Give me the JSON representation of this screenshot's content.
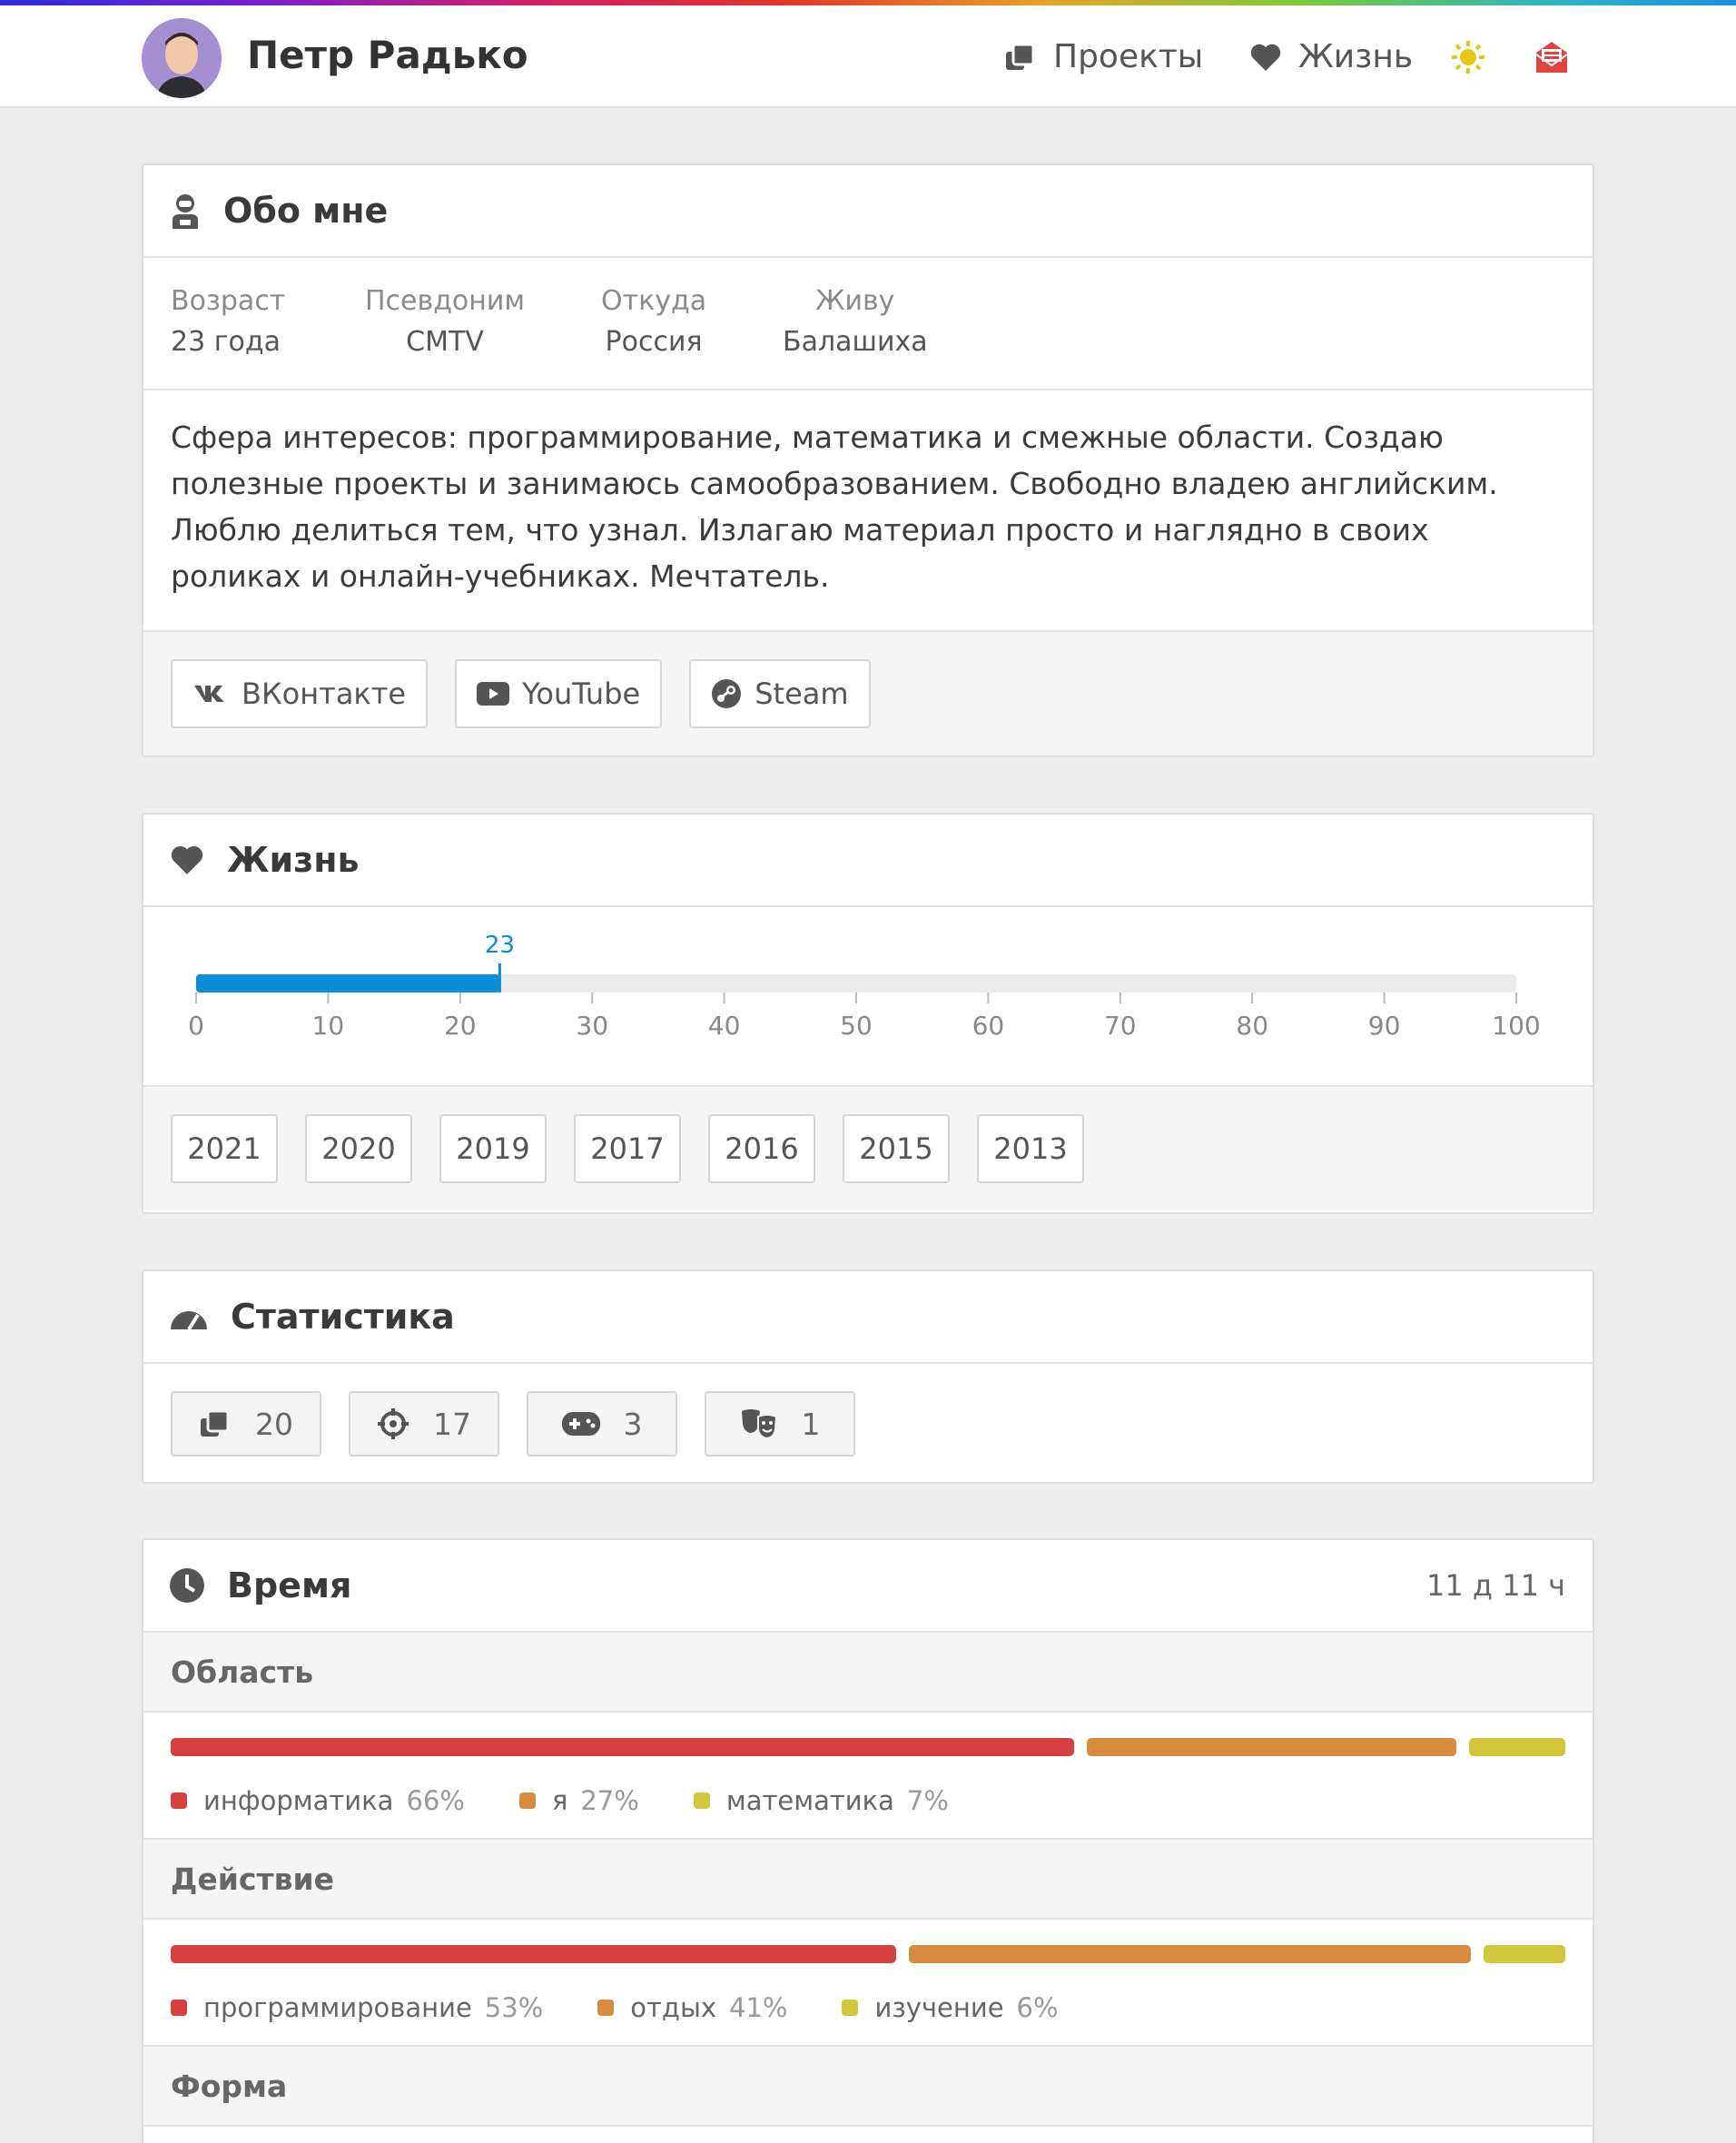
{
  "header": {
    "site_title": "Петр Радько",
    "nav": [
      {
        "label": "Проекты",
        "icon": "projects-icon"
      },
      {
        "label": "Жизнь",
        "icon": "heart-icon"
      }
    ],
    "theme_icon": "sun-icon",
    "mail_icon": "mail-icon"
  },
  "colors": {
    "accent_blue": "#0b8fd4",
    "red": "#d64040",
    "orange": "#d88a3e",
    "yellow": "#d2c63a",
    "theme_yellow": "#e6c619",
    "mail_red": "#e0443e"
  },
  "about": {
    "title": "Обо мне",
    "fields": [
      {
        "label": "Возраст",
        "value": "23 года"
      },
      {
        "label": "Псевдоним",
        "value": "CMTV"
      },
      {
        "label": "Откуда",
        "value": "Россия"
      },
      {
        "label": "Живу",
        "value": "Балашиха"
      }
    ],
    "text": "Сфера интересов: программирование, математика и смежные области. Создаю полезные проекты и занимаюсь самообразованием. Свободно владею английским. Люблю делиться тем, что узнал. Излагаю материал просто и наглядно в своих роликах и онлайн-учебниках. Мечтатель.",
    "links": [
      {
        "label": "ВКонтакте",
        "icon": "vk-icon"
      },
      {
        "label": "YouTube",
        "icon": "youtube-icon"
      },
      {
        "label": "Steam",
        "icon": "steam-icon"
      }
    ]
  },
  "life": {
    "title": "Жизнь",
    "current_age": 23,
    "current_label": "23",
    "max": 100,
    "ticks": [
      "0",
      "10",
      "20",
      "30",
      "40",
      "50",
      "60",
      "70",
      "80",
      "90",
      "100"
    ],
    "years": [
      "2021",
      "2020",
      "2019",
      "2017",
      "2016",
      "2015",
      "2013"
    ]
  },
  "stats": {
    "title": "Статистика",
    "items": [
      {
        "icon": "projects-icon",
        "value": "20"
      },
      {
        "icon": "crosshair-icon",
        "value": "17"
      },
      {
        "icon": "gamepad-icon",
        "value": "3"
      },
      {
        "icon": "theater-masks-icon",
        "value": "1"
      }
    ]
  },
  "time": {
    "title": "Время",
    "total": "11 д 11 ч",
    "sections": [
      {
        "title": "Область",
        "items": [
          {
            "label": "информатика",
            "pct_label": "66%",
            "pct": 66
          },
          {
            "label": "я",
            "pct_label": "27%",
            "pct": 27
          },
          {
            "label": "математика",
            "pct_label": "7%",
            "pct": 7
          }
        ]
      },
      {
        "title": "Действие",
        "items": [
          {
            "label": "программирование",
            "pct_label": "53%",
            "pct": 53
          },
          {
            "label": "отдых",
            "pct_label": "41%",
            "pct": 41
          },
          {
            "label": "изучение",
            "pct_label": "6%",
            "pct": 6
          }
        ]
      },
      {
        "title": "Форма",
        "items": []
      }
    ]
  }
}
